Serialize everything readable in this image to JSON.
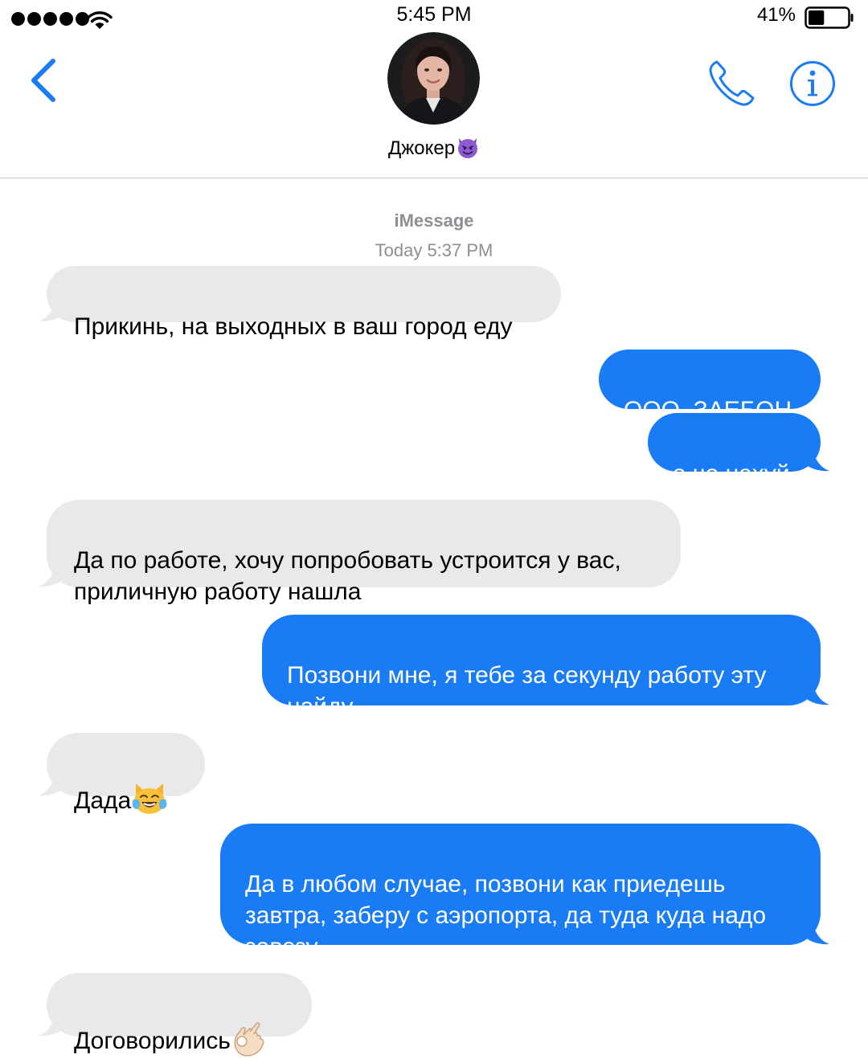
{
  "status_bar": {
    "time": "5:45 PM",
    "battery_percent": "41%",
    "battery_level": 0.41,
    "signal_bars": 5
  },
  "header": {
    "contact_name": "Джокер",
    "contact_emoji": "smiling-devil-icon",
    "back_icon": "chevron-left-icon",
    "phone_icon": "phone-icon",
    "info_icon": "info-icon"
  },
  "conversation": {
    "service": "iMessage",
    "timestamp": "Today 5:37 PM",
    "messages": [
      {
        "direction": "incoming",
        "text": "Прикинь, на выходных в ваш город еду"
      },
      {
        "direction": "outgoing",
        "text": "ООО, ЗАЕБОН"
      },
      {
        "direction": "outgoing",
        "text": "а че нахуй"
      },
      {
        "direction": "incoming",
        "text": "Да по работе, хочу попробовать устроится у вас, приличную работу нашла"
      },
      {
        "direction": "outgoing",
        "text": "Позвони мне, я тебе за секунду работу эту найду"
      },
      {
        "direction": "incoming",
        "text": "Дада",
        "emoji": "cat-tears-of-joy-icon"
      },
      {
        "direction": "outgoing",
        "text": "Да в любом случае, позвони как приедешь завтра, заберу с аэропорта, да туда куда надо завезу"
      },
      {
        "direction": "incoming",
        "text": "Договорились",
        "emoji": "ok-hand-icon"
      }
    ]
  },
  "colors": {
    "accent_blue": "#1a7cf4",
    "incoming_bubble": "#e9e9eb",
    "meta_gray": "#8e8e93",
    "divider": "#c6c6c8"
  }
}
